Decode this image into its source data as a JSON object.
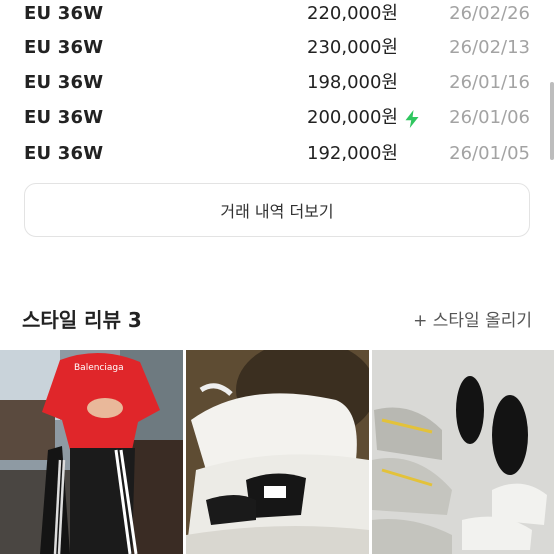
{
  "trades": [
    {
      "size": "EU 36W",
      "price": "220,000원",
      "date": "26/02/26",
      "fast": false
    },
    {
      "size": "EU 36W",
      "price": "230,000원",
      "date": "26/02/13",
      "fast": false
    },
    {
      "size": "EU 36W",
      "price": "198,000원",
      "date": "26/01/16",
      "fast": false
    },
    {
      "size": "EU 36W",
      "price": "200,000원",
      "date": "26/01/06",
      "fast": true
    },
    {
      "size": "EU 36W",
      "price": "192,000원",
      "date": "26/01/05",
      "fast": false
    }
  ],
  "more_button": "거래 내역 더보기",
  "style_review": {
    "title": "스타일 리뷰 3",
    "upload": "+ 스타일 올리기",
    "photos": [
      {
        "icon": "person-in-red-tshirt-photo",
        "logo_text": "Balenciaga"
      },
      {
        "icon": "white-sneakers-photo"
      },
      {
        "icon": "shoes-collection-photo"
      }
    ]
  },
  "colors": {
    "fast_delivery": "#2fc65f",
    "date_text": "#a3a3a3"
  }
}
